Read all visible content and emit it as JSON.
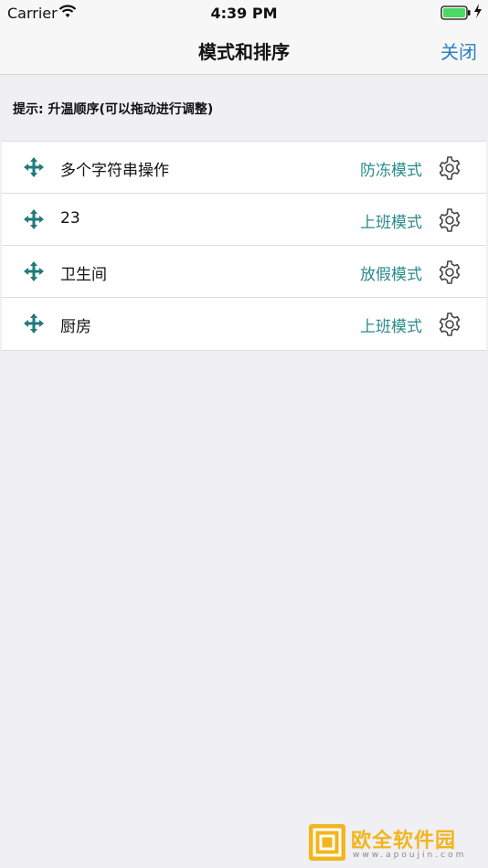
{
  "status_bar": {
    "carrier": "Carrier",
    "time": "4:39 PM",
    "icons": [
      "wifi-icon",
      "battery-icon",
      "charging-bolt-icon"
    ]
  },
  "nav": {
    "title": "模式和排序",
    "close_label": "关闭"
  },
  "hint": "提示: 升温顺序(可以拖动进行调整)",
  "rows": [
    {
      "name": "多个字符串操作",
      "mode": "防冻模式"
    },
    {
      "name": "23",
      "mode": "上班模式"
    },
    {
      "name": "卫生间",
      "mode": "放假模式"
    },
    {
      "name": "厨房",
      "mode": "上班模式"
    }
  ],
  "watermark": {
    "text": "欧全软件园",
    "url": "www.apoujin.com"
  },
  "colors": {
    "accent_link": "#2d7fc3",
    "mode_text": "#2a8a8c",
    "drag_icon": "#1f7a7a",
    "background": "#efeff4"
  }
}
